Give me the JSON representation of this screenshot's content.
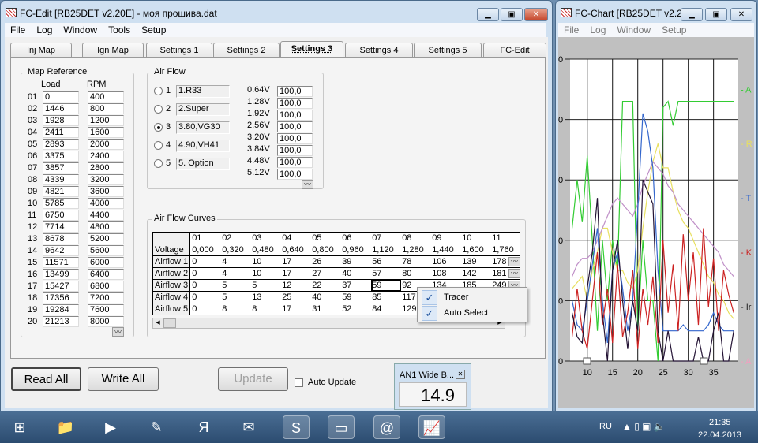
{
  "main_window": {
    "title": "FC-Edit [RB25DET v2.20E] - моя прошива.dat",
    "menu": [
      "File",
      "Log",
      "Window",
      "Tools",
      "Setup"
    ],
    "tabs": [
      "Inj Map",
      "Ign Map",
      "Settings 1",
      "Settings 2",
      "Settings 3",
      "Settings 4",
      "Settings 5",
      "FC-Edit"
    ],
    "active_tab": "Settings 3",
    "map_reference": {
      "label": "Map Reference",
      "load_header": "Load",
      "rpm_header": "RPM",
      "rows": [
        [
          "01",
          "0",
          "400"
        ],
        [
          "02",
          "1446",
          "800"
        ],
        [
          "03",
          "1928",
          "1200"
        ],
        [
          "04",
          "2411",
          "1600"
        ],
        [
          "05",
          "2893",
          "2000"
        ],
        [
          "06",
          "3375",
          "2400"
        ],
        [
          "07",
          "3857",
          "2800"
        ],
        [
          "08",
          "4339",
          "3200"
        ],
        [
          "09",
          "4821",
          "3600"
        ],
        [
          "10",
          "5785",
          "4000"
        ],
        [
          "11",
          "6750",
          "4400"
        ],
        [
          "12",
          "7714",
          "4800"
        ],
        [
          "13",
          "8678",
          "5200"
        ],
        [
          "14",
          "9642",
          "5600"
        ],
        [
          "15",
          "11571",
          "6000"
        ],
        [
          "16",
          "13499",
          "6400"
        ],
        [
          "17",
          "15427",
          "6800"
        ],
        [
          "18",
          "17356",
          "7200"
        ],
        [
          "19",
          "19284",
          "7600"
        ],
        [
          "20",
          "21213",
          "8000"
        ]
      ]
    },
    "air_flow": {
      "label": "Air Flow",
      "selected": "3",
      "options": [
        {
          "num": "1",
          "name": "1.R33"
        },
        {
          "num": "2",
          "name": "2.Super"
        },
        {
          "num": "3",
          "name": "3.80,VG30"
        },
        {
          "num": "4",
          "name": "4.90,VH41"
        },
        {
          "num": "5",
          "name": "5. Option"
        }
      ],
      "voltages": [
        [
          "0.64V",
          "100,0"
        ],
        [
          "1.28V",
          "100,0"
        ],
        [
          "1.92V",
          "100,0"
        ],
        [
          "2.56V",
          "100,0"
        ],
        [
          "3.20V",
          "100,0"
        ],
        [
          "3.84V",
          "100,0"
        ],
        [
          "4.48V",
          "100,0"
        ],
        [
          "5.12V",
          "100,0"
        ]
      ]
    },
    "air_flow_curves": {
      "label": "Air Flow Curves",
      "columns": [
        "",
        "01",
        "02",
        "03",
        "04",
        "05",
        "06",
        "07",
        "08",
        "09",
        "10",
        "11"
      ],
      "rows": [
        [
          "Voltage",
          "0,000",
          "0,320",
          "0,480",
          "0,640",
          "0,800",
          "0,960",
          "1,120",
          "1,280",
          "1,440",
          "1,600",
          "1,760"
        ],
        [
          "Airflow 1",
          "0",
          "4",
          "10",
          "17",
          "26",
          "39",
          "56",
          "78",
          "106",
          "139",
          "178"
        ],
        [
          "Airflow 2",
          "0",
          "4",
          "10",
          "17",
          "27",
          "40",
          "57",
          "80",
          "108",
          "142",
          "181"
        ],
        [
          "Airflow 3",
          "0",
          "5",
          "5",
          "12",
          "22",
          "37",
          "59",
          "92",
          "134",
          "185",
          "249"
        ],
        [
          "Airflow 4",
          "0",
          "5",
          "13",
          "25",
          "40",
          "59",
          "85",
          "117",
          "",
          "",
          ""
        ],
        [
          "Airflow 5",
          "0",
          "8",
          "8",
          "17",
          "31",
          "52",
          "84",
          "129",
          "",
          "",
          ""
        ]
      ]
    },
    "context_menu": [
      {
        "label": "Tracer",
        "checked": true
      },
      {
        "label": "Auto Select",
        "checked": true
      }
    ],
    "buttons": {
      "read_all": "Read All",
      "write_all": "Write All",
      "update": "Update",
      "auto_update": "Auto Update"
    },
    "gauge": {
      "title": "AN1 Wide B...",
      "value": "14.9"
    }
  },
  "chart_window": {
    "title": "FC-Chart [RB25DET v2.2...",
    "menu": [
      "File",
      "Log",
      "Window",
      "Setup"
    ],
    "y_labels": [
      "0",
      "0",
      "0",
      "0",
      "0",
      "0"
    ],
    "x_ticks": [
      "10",
      "15",
      "20",
      "25",
      "30",
      "35"
    ],
    "right_labels": [
      {
        "text": "A",
        "color": "#33cc33"
      },
      {
        "text": "R",
        "color": "#e8e060"
      },
      {
        "text": "T",
        "color": "#3366cc"
      },
      {
        "text": "K",
        "color": "#cc2222"
      },
      {
        "text": "Ir",
        "color": "#222222"
      },
      {
        "text": "A",
        "color": "#f0a0c0"
      }
    ]
  },
  "chart_data": {
    "type": "line",
    "xlim": [
      6.6,
      39.9
    ],
    "ylim": [
      0,
      5
    ],
    "grid": true,
    "x": [
      7,
      8,
      9,
      10,
      11,
      12,
      13,
      14,
      15,
      16,
      17,
      18,
      19,
      20,
      21,
      22,
      23,
      24,
      25,
      26,
      27,
      28,
      29,
      30,
      31,
      32,
      33,
      34,
      35,
      36,
      37,
      38,
      39
    ],
    "series": [
      {
        "color": "#33cc33",
        "values": [
          2.2,
          3.0,
          2.3,
          3.4,
          2.0,
          0.5,
          2.0,
          1.0,
          2.0,
          1.5,
          4.3,
          4.3,
          4.3,
          0.5,
          2.0,
          1.0,
          1.0,
          0.0,
          4.2,
          4.3,
          3.9,
          4.3,
          4.3,
          4.3,
          4.3,
          4.3,
          4.3,
          4.3,
          4.3,
          4.3,
          4.3,
          4.3,
          4.3
        ]
      },
      {
        "color": "#e8e060",
        "values": [
          1.2,
          1.3,
          1.4,
          1.0,
          1.5,
          1.8,
          2.2,
          2.2,
          1.8,
          1.5,
          1.5,
          1.3,
          1.2,
          1.5,
          2.2,
          2.8,
          3.3,
          3.6,
          3.2,
          3.2,
          2.8,
          2.5,
          2.3,
          2.2,
          2.0,
          1.8,
          1.6,
          1.4,
          1.3,
          1.1,
          1.0,
          0.8,
          0.7
        ]
      },
      {
        "color": "#c090c8",
        "values": [
          1.4,
          1.6,
          1.7,
          1.7,
          1.8,
          2.0,
          2.2,
          2.4,
          2.6,
          2.7,
          2.6,
          2.5,
          2.4,
          2.6,
          2.9,
          3.1,
          3.3,
          3.2,
          3.1,
          2.9,
          2.8,
          2.6,
          2.5,
          2.4,
          2.3,
          2.2,
          2.1,
          2.0,
          1.9,
          1.8,
          1.6,
          1.5,
          1.4
        ]
      },
      {
        "color": "#3366cc",
        "values": [
          1.0,
          0.6,
          0.5,
          1.0,
          1.6,
          2.2,
          1.0,
          0.3,
          1.5,
          1.8,
          1.2,
          0.5,
          1.0,
          2.5,
          4.1,
          3.8,
          3.2,
          1.5,
          0.5,
          0.5,
          0.5,
          0.5,
          0.6,
          0.5,
          0.5,
          0.5,
          0.5,
          0.6,
          0.8,
          0.6,
          0.5,
          0.5,
          0.5
        ]
      },
      {
        "color": "#cc2222",
        "values": [
          0.4,
          1.2,
          0.5,
          0.2,
          1.0,
          1.8,
          0.6,
          1.2,
          0.3,
          1.6,
          0.4,
          0.8,
          1.5,
          0.2,
          1.2,
          0.6,
          1.4,
          0.3,
          2.0,
          0.8,
          1.6,
          0.5,
          2.1,
          1.0,
          1.8,
          0.6,
          2.2,
          0.9,
          1.7,
          0.5,
          1.5,
          1.1,
          0.8
        ]
      },
      {
        "color": "#221133",
        "values": [
          0.8,
          0.4,
          0.3,
          1.2,
          1.8,
          2.7,
          0.8,
          0.0,
          1.5,
          2.0,
          1.0,
          0.2,
          1.0,
          0.5,
          3.0,
          2.8,
          2.6,
          0.5,
          0.0,
          0.5,
          0.0,
          0.0,
          0.0,
          0.0,
          0.0,
          0.4,
          0.0,
          0.0,
          0.5,
          0.8,
          0.0,
          0.0,
          0.5
        ]
      }
    ]
  },
  "taskbar": {
    "lang": "RU",
    "time": "21:35",
    "date": "22.04.2013",
    "icons": [
      "start-orb-icon",
      "file-explorer-icon",
      "media-player-icon",
      "paint-icon",
      "yandex-browser-icon",
      "mail-icon",
      "skype-icon",
      "device-icon",
      "at-mail-icon",
      "fc-chart-icon"
    ]
  }
}
